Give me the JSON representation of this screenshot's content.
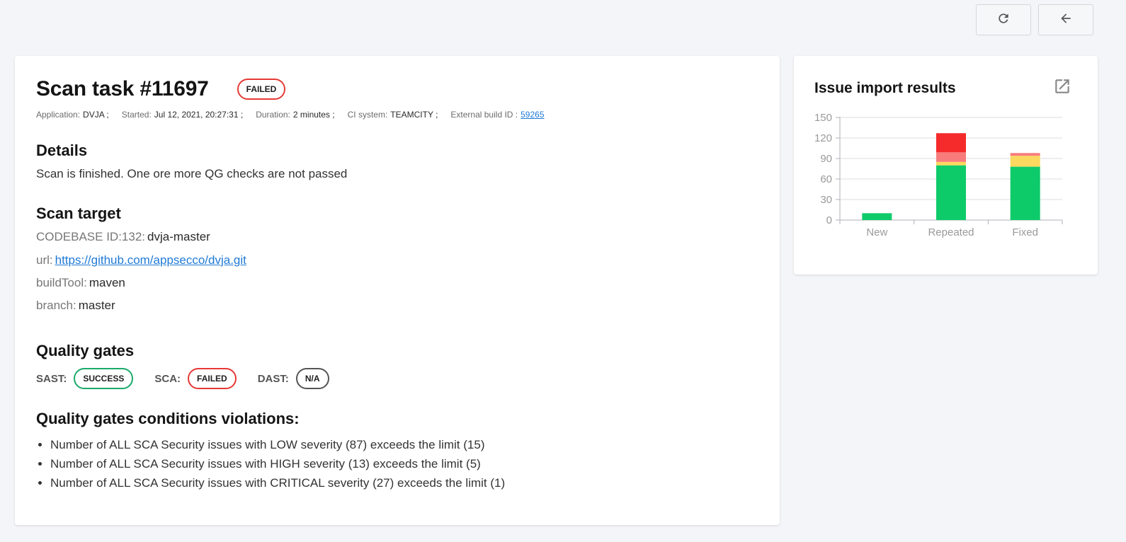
{
  "toolbar": {
    "refresh_icon": "refresh-icon",
    "back_icon": "arrow-left-icon"
  },
  "task": {
    "title": "Scan task #11697",
    "status": "FAILED",
    "meta": {
      "application_label": "Application:",
      "application": "DVJA ;",
      "started_label": "Started:",
      "started": "Jul 12, 2021, 20:27:31 ;",
      "duration_label": "Duration:",
      "duration": "2 minutes ;",
      "ci_label": "CI system:",
      "ci": "TEAMCITY ;",
      "build_label": "External build ID :",
      "build_id": "59265"
    }
  },
  "details": {
    "heading": "Details",
    "text": "Scan is finished. One ore more QG checks are not passed"
  },
  "scan_target": {
    "heading": "Scan target",
    "codebase_label": "CODEBASE ID:132:",
    "codebase_value": "dvja-master",
    "url_label": "url:",
    "url_value": "https://github.com/appsecco/dvja.git",
    "buildtool_label": "buildTool:",
    "buildtool_value": "maven",
    "branch_label": "branch:",
    "branch_value": "master"
  },
  "quality_gates": {
    "heading": "Quality gates",
    "sast_label": "SAST:",
    "sast_status": "SUCCESS",
    "sca_label": "SCA:",
    "sca_status": "FAILED",
    "dast_label": "DAST:",
    "dast_status": "N/A"
  },
  "violations": {
    "heading": "Quality gates conditions violations:",
    "items": [
      "Number of ALL SCA Security issues with LOW severity (87) exceeds the limit (15)",
      "Number of ALL SCA Security issues with HIGH severity (13) exceeds the limit (5)",
      "Number of ALL SCA Security issues with CRITICAL severity (27) exceeds the limit (1)"
    ]
  },
  "colors": {
    "failed": "#e53935",
    "success": "#1aaa6a",
    "link": "#1f7ad6"
  },
  "chart_card": {
    "title": "Issue import results",
    "open_icon": "open-in-new-icon"
  },
  "chart_data": {
    "type": "bar",
    "stacked": true,
    "categories": [
      "New",
      "Repeated",
      "Fixed"
    ],
    "ylim": [
      0,
      150
    ],
    "yticks": [
      0,
      30,
      60,
      90,
      120,
      150
    ],
    "grid": true,
    "series": [
      {
        "color": "#0ecb6a",
        "values": [
          10,
          80,
          78
        ]
      },
      {
        "color": "#fbd85f",
        "values": [
          0,
          5,
          16
        ]
      },
      {
        "color": "#f87c7c",
        "values": [
          0,
          14,
          4
        ]
      },
      {
        "color": "#f52a2a",
        "values": [
          0,
          28,
          0
        ]
      }
    ]
  }
}
